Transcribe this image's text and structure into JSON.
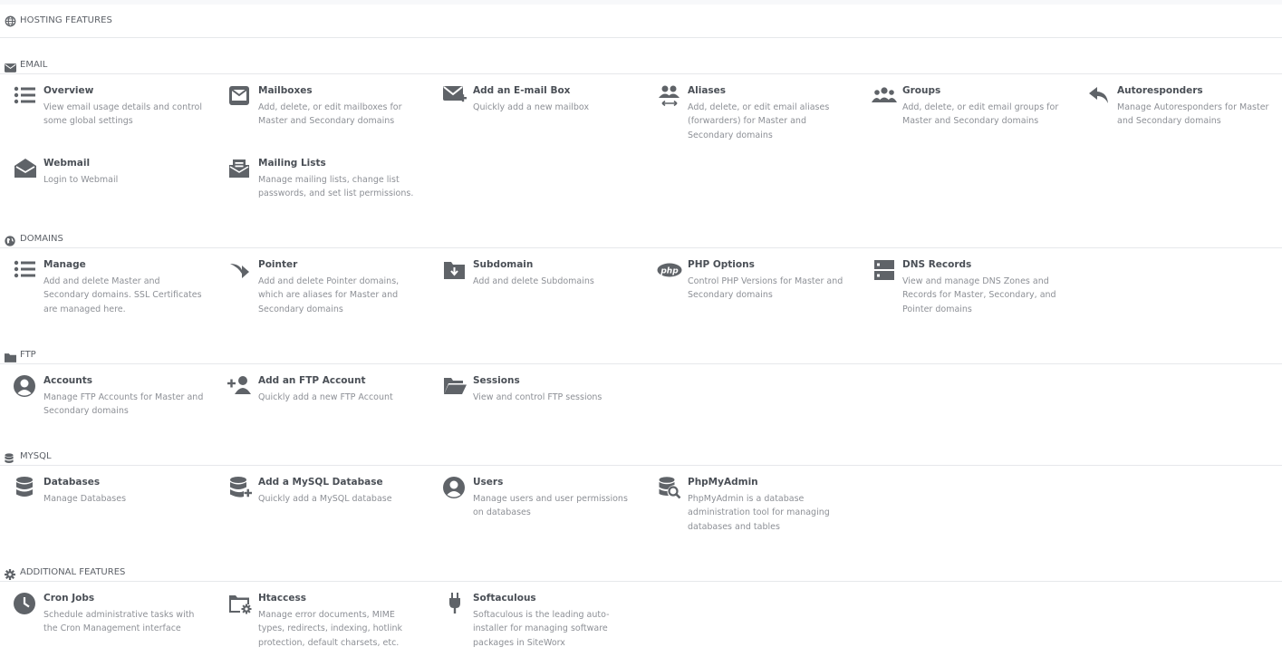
{
  "header": {
    "title": "HOSTING FEATURES",
    "icon": "globe-icon"
  },
  "colors": {
    "icon": "#5f6368",
    "title": "#4a4f56",
    "desc": "#8d9096",
    "divider": "#e6e8eb"
  },
  "sections": [
    {
      "title": "EMAIL",
      "icon": "envelope-icon",
      "items": [
        {
          "title": "Overview",
          "desc": "View email usage details and control some global settings",
          "icon": "list-icon"
        },
        {
          "title": "Mailboxes",
          "desc": "Add, delete, or edit mailboxes for Master and Secondary domains",
          "icon": "mailbox-icon"
        },
        {
          "title": "Add an E-mail Box",
          "desc": "Quickly add a new mailbox",
          "icon": "envelope-plus-icon"
        },
        {
          "title": "Aliases",
          "desc": "Add, delete, or edit email aliases (forwarders) for Master and Secondary domains",
          "icon": "users-arrows-icon"
        },
        {
          "title": "Groups",
          "desc": "Add, delete, or edit email groups for Master and Secondary domains",
          "icon": "group-icon"
        },
        {
          "title": "Autoresponders",
          "desc": "Manage Autoresponders for Master and Secondary domains",
          "icon": "reply-icon"
        },
        {
          "title": "Webmail",
          "desc": "Login to Webmail",
          "icon": "envelope-open-icon"
        },
        {
          "title": "Mailing Lists",
          "desc": "Manage mailing lists, change list passwords, and set list permissions.",
          "icon": "mail-bulk-icon"
        }
      ]
    },
    {
      "title": "DOMAINS",
      "icon": "globe-solid-icon",
      "items": [
        {
          "title": "Manage",
          "desc": "Add and delete Master and Secondary domains. SSL Certificates are managed here.",
          "icon": "list-icon"
        },
        {
          "title": "Pointer",
          "desc": "Add and delete Pointer domains, which are aliases for Master and Secondary domains",
          "icon": "share-arrow-icon"
        },
        {
          "title": "Subdomain",
          "desc": "Add and delete Subdomains",
          "icon": "folder-download-icon"
        },
        {
          "title": "PHP Options",
          "desc": "Control PHP Versions for Master and Secondary domains",
          "icon": "php-icon"
        },
        {
          "title": "DNS Records",
          "desc": "View and manage DNS Zones and Records for Master, Secondary, and Pointer domains",
          "icon": "server-icon"
        }
      ]
    },
    {
      "title": "FTP",
      "icon": "folder-icon",
      "items": [
        {
          "title": "Accounts",
          "desc": "Manage FTP Accounts for Master and Secondary domains",
          "icon": "user-circle-icon"
        },
        {
          "title": "Add an FTP Account",
          "desc": "Quickly add a new FTP Account",
          "icon": "user-plus-icon"
        },
        {
          "title": "Sessions",
          "desc": "View and control FTP sessions",
          "icon": "folder-open-icon"
        }
      ]
    },
    {
      "title": "MYSQL",
      "icon": "database-icon",
      "items": [
        {
          "title": "Databases",
          "desc": "Manage Databases",
          "icon": "database-icon"
        },
        {
          "title": "Add a MySQL Database",
          "desc": "Quickly add a MySQL database",
          "icon": "database-plus-icon"
        },
        {
          "title": "Users",
          "desc": "Manage users and user permissions on databases",
          "icon": "user-circle-icon"
        },
        {
          "title": "PhpMyAdmin",
          "desc": "PhpMyAdmin is a database administration tool for managing databases and tables",
          "icon": "database-search-icon"
        }
      ]
    },
    {
      "title": "ADDITIONAL FEATURES",
      "icon": "gear-icon",
      "items": [
        {
          "title": "Cron Jobs",
          "desc": "Schedule administrative tasks with the Cron Management interface",
          "icon": "clock-icon"
        },
        {
          "title": "Htaccess",
          "desc": "Manage error documents, MIME types, redirects, indexing, hotlink protection, default charsets, etc.",
          "icon": "folder-gear-icon"
        },
        {
          "title": "Softaculous",
          "desc": "Softaculous is the leading auto-installer for managing software packages in SiteWorx",
          "icon": "plug-icon"
        }
      ]
    }
  ]
}
